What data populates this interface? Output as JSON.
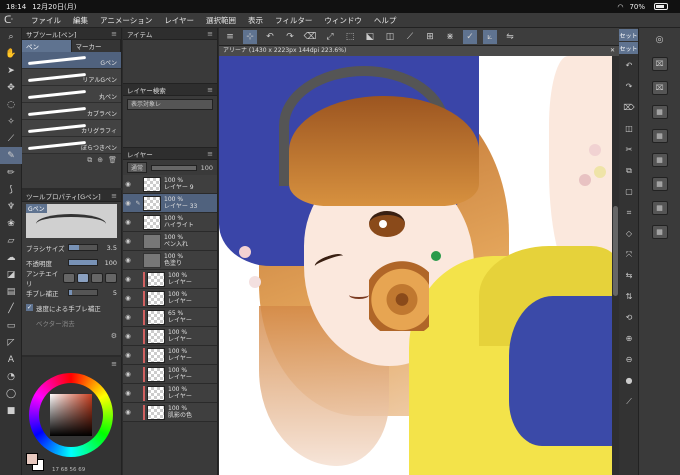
{
  "status": {
    "time": "18:14",
    "date": "12月20日(月)",
    "battery": "70%"
  },
  "menu": [
    "ファイル",
    "編集",
    "アニメーション",
    "レイヤー",
    "選択範囲",
    "表示",
    "フィルター",
    "ウィンドウ",
    "ヘルプ"
  ],
  "subtool": {
    "title": "サブツール[ペン]",
    "tabs": [
      "ペン",
      "マーカー"
    ],
    "brushes": [
      "Gペン",
      "リアルGペン",
      "丸ペン",
      "カブラペン",
      "カリグラフィ",
      "ぼらつきペン"
    ]
  },
  "toolprop": {
    "title": "ツールプロパティ[Gペン]",
    "brush_tag": "Gペン",
    "brush_size_label": "ブラシサイズ",
    "brush_size": "3.5",
    "opacity_label": "不透明度",
    "opacity": "100",
    "antialias_label": "アンチエイリ",
    "stabilize_label": "手ブレ補正",
    "stabilize": "5",
    "speed_label": "速度による手ブレ補正",
    "vector_label": "ベクター消去"
  },
  "color": {
    "values": "17  68  56  69"
  },
  "panels": {
    "item": "アイテム",
    "layer_search": "レイヤー検索",
    "search_placeholder": "表示対象レ",
    "layer": "レイヤー",
    "blend_mode": "通常",
    "layer_opacity": "100"
  },
  "layers": [
    {
      "pct": "100 %",
      "name": "レイヤー 9"
    },
    {
      "pct": "100 %",
      "name": "レイヤー 33"
    },
    {
      "pct": "100 %",
      "name": "ハイライト"
    },
    {
      "pct": "100 %",
      "name": "ペン入れ"
    },
    {
      "pct": "100 %",
      "name": "色塗り"
    },
    {
      "pct": "100 %",
      "name": "レイヤー"
    },
    {
      "pct": "100 %",
      "name": "レイヤー"
    },
    {
      "pct": "65 %",
      "name": "レイヤー"
    },
    {
      "pct": "100 %",
      "name": "レイヤー"
    },
    {
      "pct": "100 %",
      "name": "レイヤー"
    },
    {
      "pct": "100 %",
      "name": "レイヤー"
    },
    {
      "pct": "100 %",
      "name": "レイヤー"
    },
    {
      "pct": "100 %",
      "name": "肌影の色"
    }
  ],
  "canvas": {
    "doc_title": "アリーナ (1430 x 2223px 144dpi 223.6%)"
  },
  "right": {
    "set1": "セット",
    "set2": "セット"
  }
}
